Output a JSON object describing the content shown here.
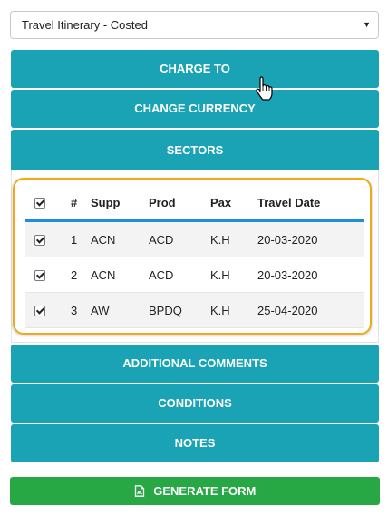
{
  "form_select": {
    "value": "Travel Itinerary - Costed"
  },
  "panels": {
    "charge_to": "CHARGE TO",
    "change_currency": "CHANGE CURRENCY",
    "sectors": "SECTORS",
    "additional_comments": "ADDITIONAL COMMENTS",
    "conditions": "CONDITIONS",
    "notes": "NOTES"
  },
  "sectors_table": {
    "headers": {
      "num": "#",
      "supp": "Supp",
      "prod": "Prod",
      "pax": "Pax",
      "date": "Travel Date"
    },
    "rows": [
      {
        "checked": true,
        "num": "1",
        "supp": "ACN",
        "prod": "ACD",
        "pax": "K.H",
        "date": "20-03-2020"
      },
      {
        "checked": true,
        "num": "2",
        "supp": "ACN",
        "prod": "ACD",
        "pax": "K.H",
        "date": "20-03-2020"
      },
      {
        "checked": true,
        "num": "3",
        "supp": "AW",
        "prod": "BPDQ",
        "pax": "K.H",
        "date": "25-04-2020"
      }
    ]
  },
  "generate_button": {
    "label": "GENERATE FORM",
    "icon": "pdf-file-icon"
  },
  "colors": {
    "panel": "#1aa3b4",
    "generate": "#28a745",
    "highlight": "#f0a91b",
    "header_rule": "#1c8fd8"
  }
}
